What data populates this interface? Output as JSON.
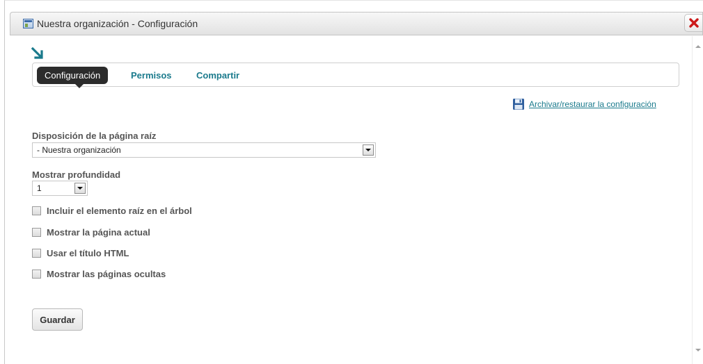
{
  "window": {
    "title": "Nuestra organización - Configuración",
    "icon": "window-icon",
    "close_icon": "close-icon"
  },
  "tabs": [
    {
      "label": "Configuración",
      "active": true
    },
    {
      "label": "Permisos",
      "active": false
    },
    {
      "label": "Compartir",
      "active": false
    }
  ],
  "archive": {
    "label": "Archivar/restaurar la configuración",
    "icon": "floppy-disk-icon"
  },
  "form": {
    "root_layout": {
      "label": "Disposición de la página raíz",
      "value": "- Nuestra organización"
    },
    "depth": {
      "label": "Mostrar profundidad",
      "value": "1"
    },
    "checkboxes": [
      {
        "label": "Incluir el elemento raíz en el árbol",
        "checked": false
      },
      {
        "label": "Mostrar la página actual",
        "checked": false
      },
      {
        "label": "Usar el título HTML",
        "checked": false
      },
      {
        "label": "Mostrar las páginas ocultas",
        "checked": false
      }
    ],
    "save_label": "Guardar"
  },
  "colors": {
    "accent": "#1a7a8c",
    "active_tab_bg": "#2c2c2c",
    "close_red": "#cc1a1a"
  }
}
